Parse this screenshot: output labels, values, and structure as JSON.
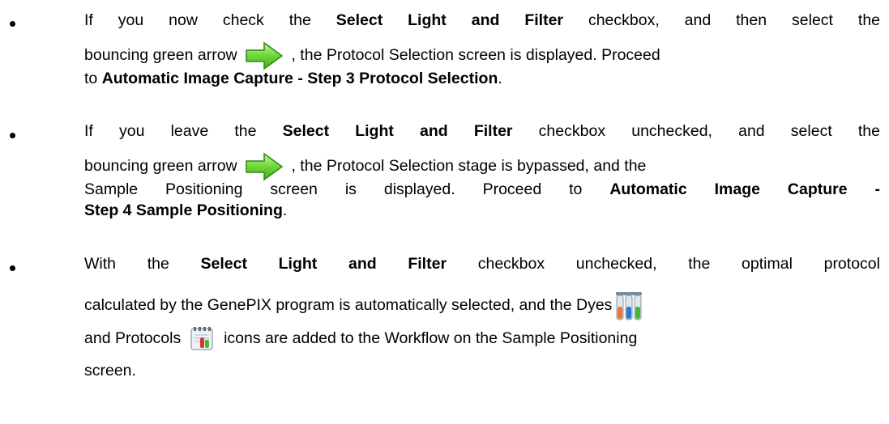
{
  "bullets": [
    {
      "line1": {
        "a": "If you now check the ",
        "b": "Select Light and Filter",
        "c": " checkbox, and then select the"
      },
      "line2": {
        "a": "bouncing green arrow",
        "icon": "green-arrow-icon",
        "b": " , the Protocol Selection screen is displayed. Proceed"
      },
      "line3": {
        "a": "to ",
        "b": "Automatic Image Capture - Step 3  Protocol Selection",
        "c": "."
      }
    },
    {
      "line1": {
        "a": "If you leave the ",
        "b": "Select Light and Filter",
        "c": " checkbox unchecked, and select the"
      },
      "line2": {
        "a": "bouncing green arrow",
        "icon": "green-arrow-icon",
        "b": " , the Protocol Selection stage is bypassed, and the"
      },
      "line3": {
        "a": "Sample Positioning screen is displayed. Proceed to ",
        "b": "Automatic Image Capture -"
      },
      "line4": {
        "b": "Step 4  Sample Positioning",
        "c": "."
      }
    },
    {
      "line1": {
        "a": "With the ",
        "b": "Select Light and Filter",
        "c": " checkbox unchecked, the optimal protocol"
      },
      "line2": {
        "a": "calculated by the GenePIX program is automatically selected, and the Dyes",
        "icon": "dyes-icon"
      },
      "line3": {
        "a": "and Protocols",
        "icon": "protocols-icon",
        "b": "icons are added to the Workflow on the Sample Positioning"
      },
      "line4": {
        "a": "screen."
      }
    }
  ],
  "colors": {
    "text": "#000000",
    "arrow_green": "#4cc21f",
    "arrow_light": "#aef07a",
    "arrow_border": "#2a8a12"
  }
}
